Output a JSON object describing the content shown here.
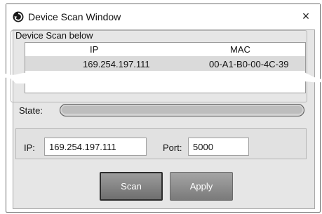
{
  "window": {
    "title": "Device Scan Window",
    "close_glyph": "×",
    "title_icon": "refresh-icon",
    "colors": {
      "button_bg": "#7f7f7f",
      "client_bg": "#e6e6e6",
      "selection_bg": "#dadada"
    }
  },
  "device_scan": {
    "group_label": "Device Scan below",
    "columns": [
      "IP",
      "MAC"
    ],
    "rows": [
      {
        "ip": "169.254.197.111",
        "mac": "00-A1-B0-00-4C-39"
      }
    ]
  },
  "state": {
    "label": "State:"
  },
  "connection": {
    "ip_label": "IP:",
    "ip_value": "169.254.197.111",
    "port_label": "Port:",
    "port_value": "5000"
  },
  "buttons": {
    "scan_label": "Scan",
    "apply_label": "Apply"
  }
}
